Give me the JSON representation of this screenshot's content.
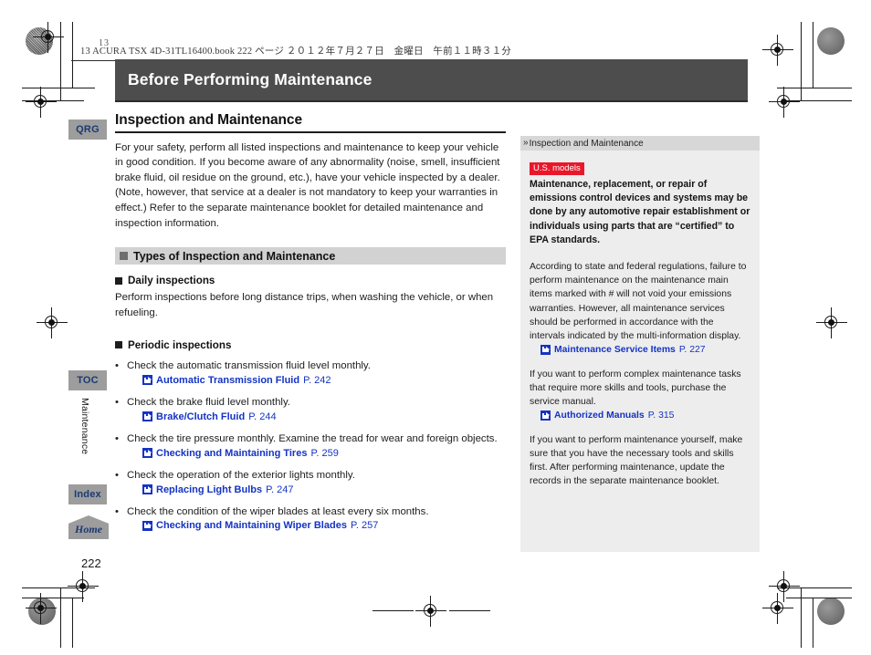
{
  "print_marks": {
    "corner_label": "13"
  },
  "book_header": "13 ACURA TSX 4D-31TL16400.book  222 ページ  ２０１２年７月２７日　金曜日　午前１１時３１分",
  "chapter_title": "Before Performing Maintenance",
  "page_number": "222",
  "rail": {
    "qrg_label": "QRG",
    "toc_label": "TOC",
    "index_label": "Index",
    "home_label": "Home",
    "chapter_tab_label": "Maintenance"
  },
  "main": {
    "section_title": "Inspection and Maintenance",
    "intro": "For your safety, perform all listed inspections and maintenance to keep your vehicle in good condition. If you become aware of any abnormality (noise, smell, insufficient brake fluid, oil residue on the ground, etc.), have your vehicle inspected by a dealer. (Note, however, that service at a dealer is not mandatory to keep your warranties in effect.) Refer to the separate maintenance booklet for detailed maintenance and inspection information.",
    "subsection_title": "Types of Inspection and Maintenance",
    "daily": {
      "heading": "Daily inspections",
      "text": "Perform inspections before long distance trips, when washing the vehicle, or when refueling."
    },
    "periodic": {
      "heading": "Periodic inspections",
      "items": [
        {
          "text": "Check the automatic transmission fluid level monthly.",
          "xref_title": "Automatic Transmission Fluid",
          "xref_page": "P. 242"
        },
        {
          "text": "Check the brake fluid level monthly.",
          "xref_title": "Brake/Clutch Fluid",
          "xref_page": "P. 244"
        },
        {
          "text": "Check the tire pressure monthly. Examine the tread for wear and foreign objects.",
          "xref_title": "Checking and Maintaining Tires",
          "xref_page": "P. 259"
        },
        {
          "text": "Check the operation of the exterior lights monthly.",
          "xref_title": "Replacing Light Bulbs",
          "xref_page": "P. 247"
        },
        {
          "text": "Check the condition of the wiper blades at least every six months.",
          "xref_title": "Checking and Maintaining Wiper Blades",
          "xref_page": "P. 257"
        }
      ]
    }
  },
  "side": {
    "header": "Inspection and Maintenance",
    "badge": "U.S. models",
    "bold_text": "Maintenance, replacement, or repair of emissions control devices and systems may be done by any automotive repair establishment or individuals using parts that are “certified” to EPA standards.",
    "paragraph_1": "According to state and federal regulations, failure to perform maintenance on the maintenance main items marked with # will not void your emissions warranties. However, all maintenance services should be performed in accordance with the intervals indicated by the multi-information display.",
    "xref_1_title": "Maintenance Service Items",
    "xref_1_page": "P. 227",
    "paragraph_2": "If you want to perform complex maintenance tasks that require more skills and tools, purchase the service manual.",
    "xref_2_title": "Authorized Manuals",
    "xref_2_page": "P. 315",
    "paragraph_3": "If you want to perform maintenance yourself, make sure that you have the necessary tools and skills first. After performing maintenance, update the records in the separate maintenance booklet."
  },
  "colors": {
    "title_bar": "#4d4d4d",
    "xref_blue": "#1433c4",
    "badge_red": "#e8182a",
    "rail_gray": "#9d9d9d",
    "side_panel": "#ededed"
  }
}
